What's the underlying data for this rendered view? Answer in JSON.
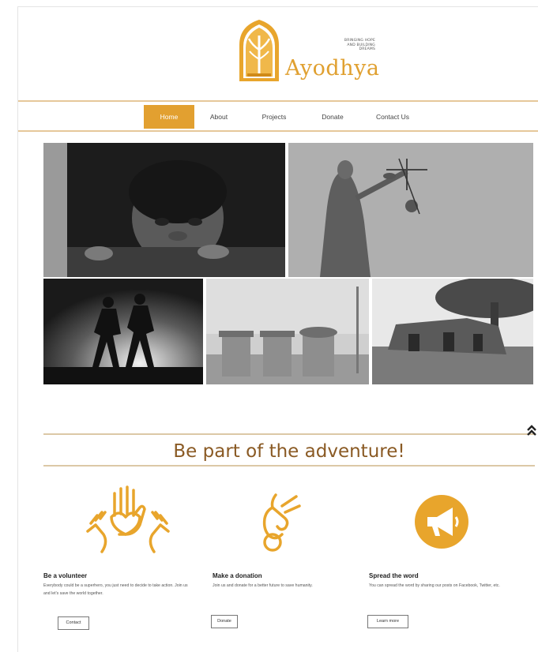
{
  "brand": {
    "name": "Ayodhya",
    "tagline_lines": [
      "BRINGING HOPE",
      "AND BUILDING",
      "DREAMS"
    ],
    "accent_color": "#e2a030",
    "title_color": "#8a5a24"
  },
  "nav": {
    "items": [
      {
        "label": "Home",
        "active": true
      },
      {
        "label": "About",
        "active": false
      },
      {
        "label": "Projects",
        "active": false
      },
      {
        "label": "Donate",
        "active": false
      },
      {
        "label": "Contact Us",
        "active": false
      }
    ]
  },
  "gallery": {
    "photos": [
      "child-peeking-photo",
      "lady-justice-statue-photo",
      "running-silhouettes-photo",
      "trash-bins-photo",
      "rural-huts-photo"
    ]
  },
  "adventure": {
    "title": "Be part of the adventure!",
    "scroll_top_icon": "double-chevron-up-icon"
  },
  "features": [
    {
      "icon": "raised-hands-heart-icon",
      "title": "Be a volunteer",
      "text": "Everybody could be a superhero, you just need to decide to take action. Join us and let's save the world together.",
      "button": "Contact"
    },
    {
      "icon": "hand-coin-icon",
      "title": "Make a donation",
      "text": "Join us and donate for a better future to save humanity.",
      "button": "Donate"
    },
    {
      "icon": "megaphone-icon",
      "title": "Spread the word",
      "text": "You can spread the word by sharing our posts on Facebook, Twitter, etc.",
      "button": "Learn more"
    }
  ]
}
